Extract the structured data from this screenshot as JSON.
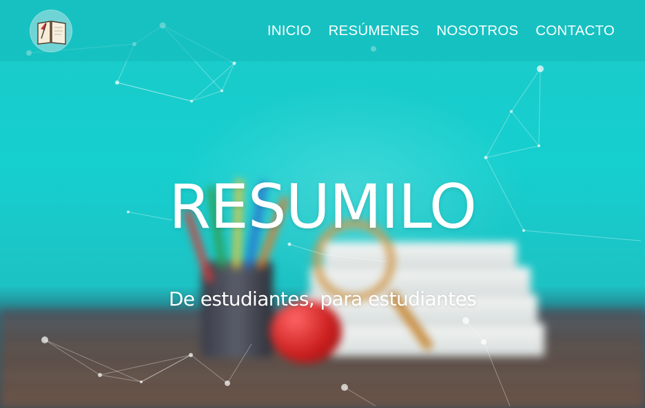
{
  "nav": {
    "logo_icon": "open-book-quill-icon",
    "items": [
      {
        "label": "INICIO"
      },
      {
        "label": "RESÚMENES"
      },
      {
        "label": "NOSOTROS"
      },
      {
        "label": "CONTACTO"
      }
    ]
  },
  "hero": {
    "title": "RESUMILO",
    "subtitle": "De estudiantes, para estudiantes"
  },
  "colors": {
    "accent": "#1ccaca",
    "text": "#ffffff"
  }
}
